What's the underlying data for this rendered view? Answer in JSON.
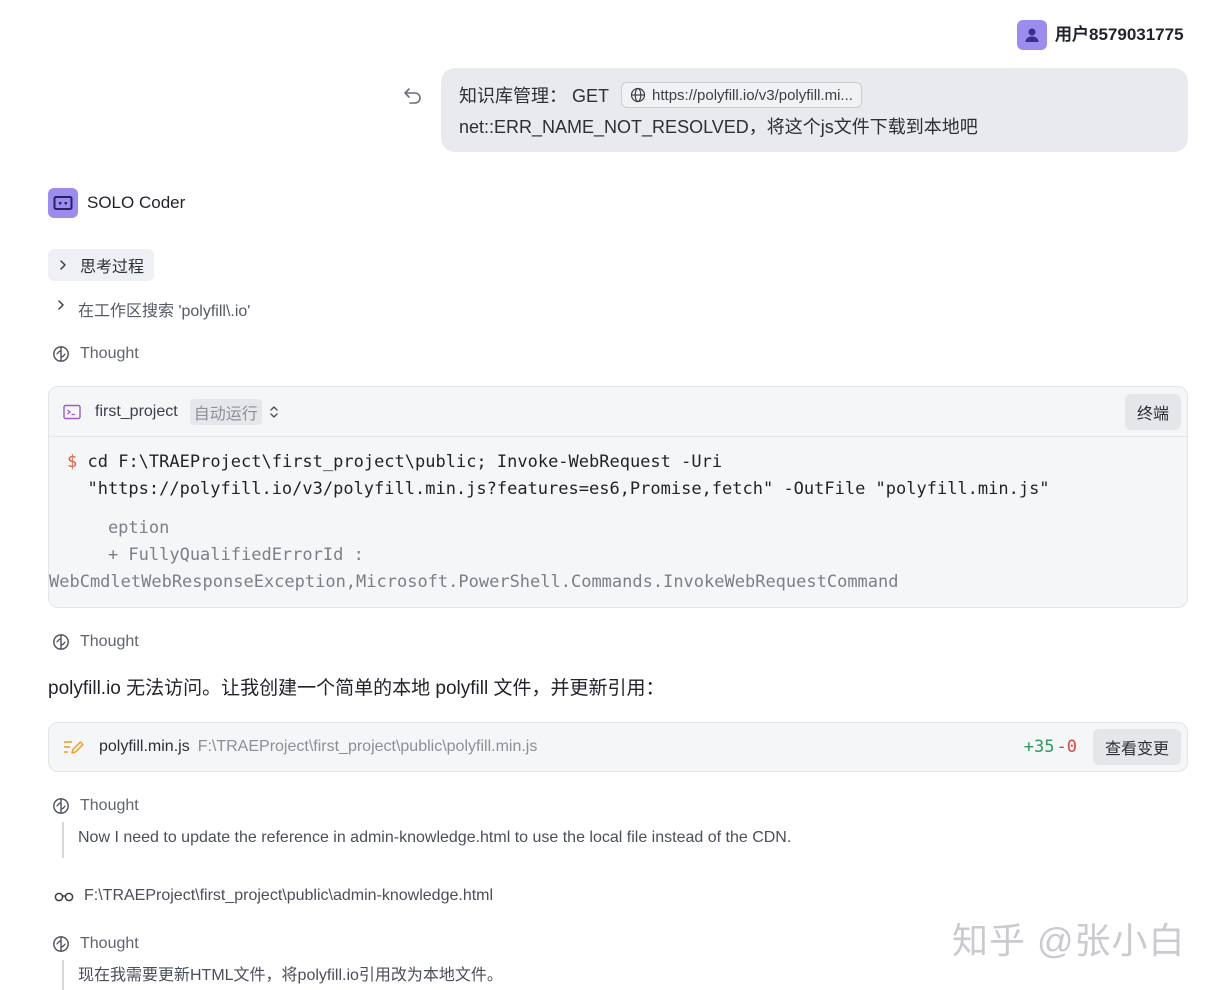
{
  "user": {
    "name": "用户8579031775"
  },
  "user_message": {
    "prefix": "知识库管理： GET",
    "url_chip": "https://polyfill.io/v3/polyfill.mi...",
    "line2": "net::ERR_NAME_NOT_RESOLVED，将这个js文件下载到本地吧"
  },
  "agent": {
    "name": "SOLO Coder"
  },
  "thinking": {
    "label": "思考过程"
  },
  "search_step": {
    "label": "在工作区搜索 'polyfill\\.io'"
  },
  "thought_label": "Thought",
  "terminal": {
    "project": "first_project",
    "mode": "自动运行",
    "button": "终端",
    "prompt": "$",
    "command_line1": "cd F:\\TRAEProject\\first_project\\public; Invoke-WebRequest -Uri",
    "command_line2": "  \"https://polyfill.io/v3/polyfill.min.js?features=es6,Promise,fetch\" -OutFile \"polyfill.min.js\"",
    "output_line1": "    eption",
    "output_line2": "    + FullyQualifiedErrorId :",
    "output_line3": "WebCmdletWebResponseException,Microsoft.PowerShell.Commands.InvokeWebRequestCommand"
  },
  "reply": "polyfill.io 无法访问。让我创建一个简单的本地 polyfill 文件，并更新引用：",
  "file_change": {
    "name": "polyfill.min.js",
    "path": "F:\\TRAEProject\\first_project\\public\\polyfill.min.js",
    "added": "+35",
    "removed": "-0",
    "button": "查看变更"
  },
  "thought3_text": "Now I need to update the reference in admin-knowledge.html to use the local file instead of the CDN.",
  "read_step": {
    "path": "F:\\TRAEProject\\first_project\\public\\admin-knowledge.html"
  },
  "thought4_text": "现在我需要更新HTML文件，将polyfill.io引用改为本地文件。",
  "watermark": "知乎 @张小白",
  "colors": {
    "accent": "#9b8cf0",
    "added": "#2e9a5b",
    "removed": "#d9463e"
  }
}
